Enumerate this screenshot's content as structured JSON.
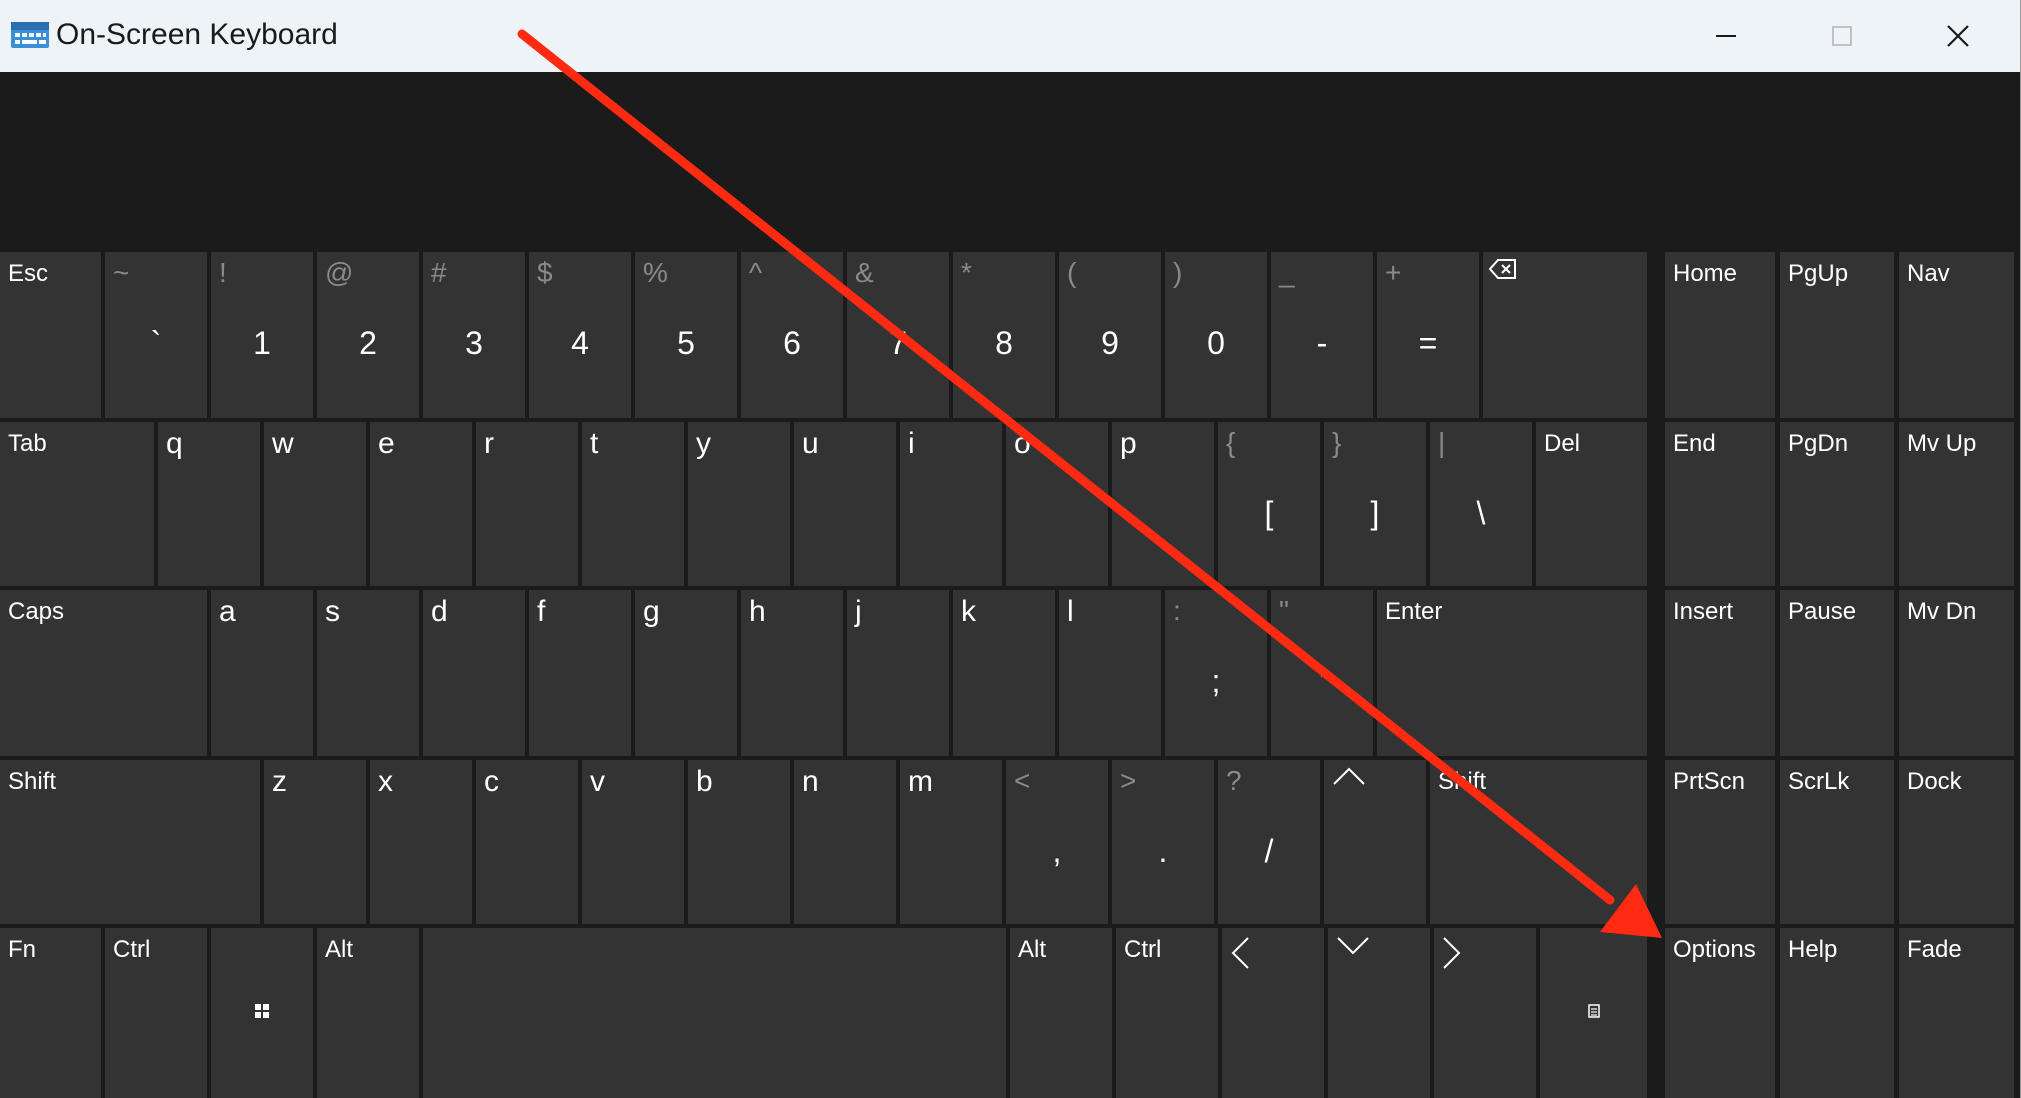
{
  "window": {
    "title": "On-Screen Keyboard"
  },
  "titlebar_icons": {
    "app": "keyboard-icon",
    "minimize": "minimize-icon",
    "maximize": "maximize-icon",
    "close": "close-icon"
  },
  "keys": {
    "esc": "Esc",
    "tilde_sec": "~",
    "tilde_pri": "`",
    "k1_sec": "!",
    "k1_pri": "1",
    "k2_sec": "@",
    "k2_pri": "2",
    "k3_sec": "#",
    "k3_pri": "3",
    "k4_sec": "$",
    "k4_pri": "4",
    "k5_sec": "%",
    "k5_pri": "5",
    "k6_sec": "^",
    "k6_pri": "6",
    "k7_sec": "&",
    "k7_pri": "7",
    "k8_sec": "*",
    "k8_pri": "8",
    "k9_sec": "(",
    "k9_pri": "9",
    "k0_sec": ")",
    "k0_pri": "0",
    "minus_sec": "_",
    "minus_pri": "-",
    "equal_sec": "+",
    "equal_pri": "=",
    "tab": "Tab",
    "q": "q",
    "w": "w",
    "e": "e",
    "r": "r",
    "t": "t",
    "y": "y",
    "u": "u",
    "i": "i",
    "o": "o",
    "p": "p",
    "lbrace_sec": "{",
    "lbrace_pri": "[",
    "rbrace_sec": "}",
    "rbrace_pri": "]",
    "pipe_sec": "|",
    "pipe_pri": "\\",
    "del": "Del",
    "caps": "Caps",
    "a": "a",
    "s": "s",
    "d": "d",
    "f": "f",
    "g": "g",
    "h": "h",
    "j": "j",
    "k": "k",
    "l": "l",
    "semi_sec": ":",
    "semi_pri": ";",
    "quote_sec": "\"",
    "quote_pri": "'",
    "enter": "Enter",
    "shift_left": "Shift",
    "z": "z",
    "x": "x",
    "c": "c",
    "v": "v",
    "b": "b",
    "n": "n",
    "m": "m",
    "comma_sec": "<",
    "comma_pri": ",",
    "period_sec": ">",
    "period_pri": ".",
    "slash_sec": "?",
    "slash_pri": "/",
    "shift_right": "Shift",
    "fn": "Fn",
    "ctrl_left": "Ctrl",
    "alt_left": "Alt",
    "alt_right": "Alt",
    "ctrl_right": "Ctrl",
    "home": "Home",
    "pgup": "PgUp",
    "nav": "Nav",
    "end": "End",
    "pgdn": "PgDn",
    "mvup": "Mv Up",
    "insert": "Insert",
    "pause": "Pause",
    "mvdn": "Mv Dn",
    "prtscn": "PrtScn",
    "scrlk": "ScrLk",
    "dock": "Dock",
    "options": "Options",
    "help": "Help",
    "fade": "Fade"
  },
  "key_icons": {
    "backspace": "backspace-icon",
    "up": "arrow-up-icon",
    "left": "arrow-left-icon",
    "down": "arrow-down-icon",
    "right": "arrow-right-icon",
    "windows": "windows-logo-icon",
    "menu": "context-menu-icon"
  },
  "annotation": {
    "arrow_color": "#ff2a12",
    "description_icon": "red-arrow-icon"
  },
  "colors": {
    "key": "#333333",
    "board": "#1b1b1b",
    "titlebar": "#eef3f8"
  }
}
